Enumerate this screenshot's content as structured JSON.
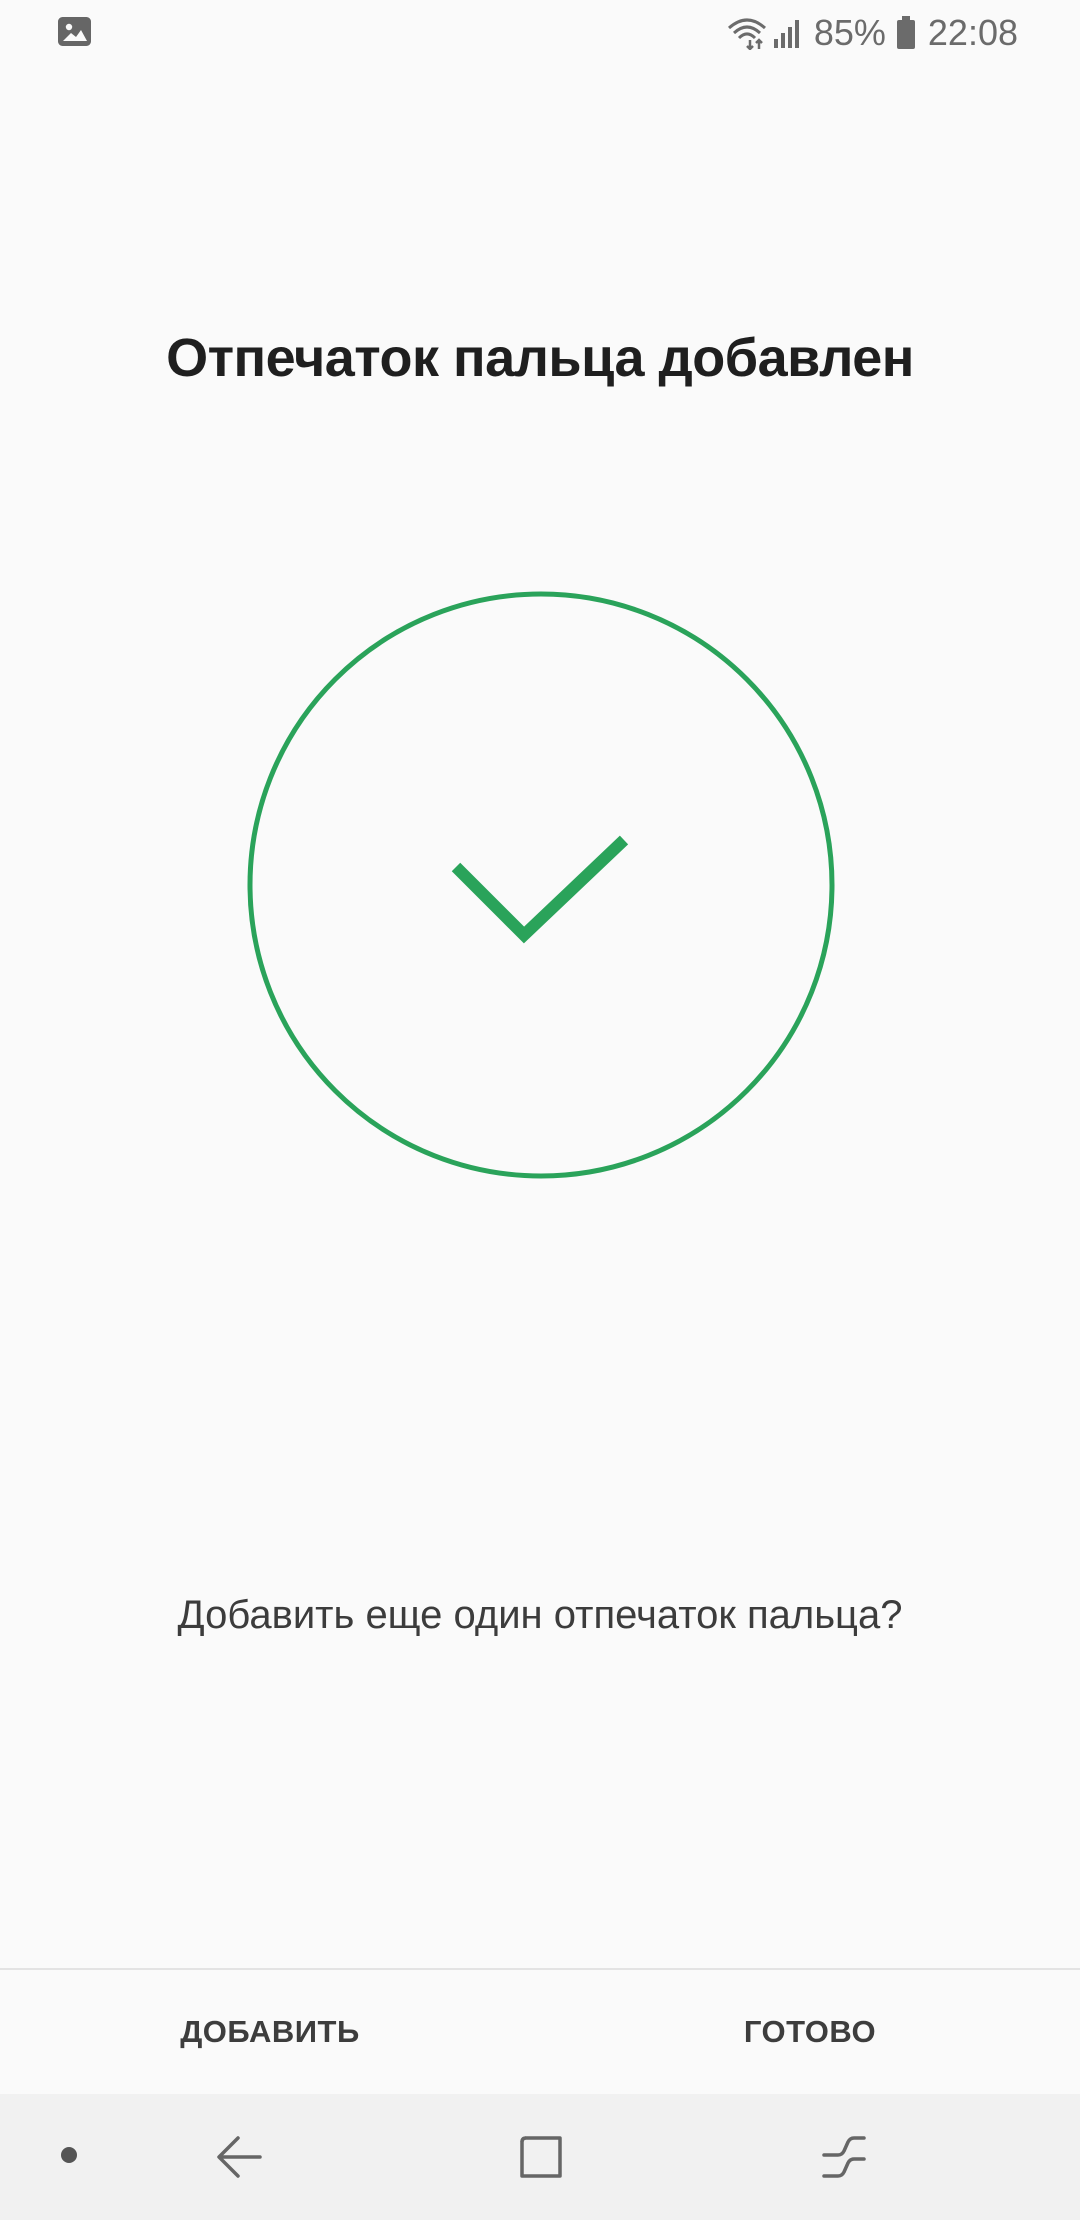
{
  "status_bar": {
    "battery": "85%",
    "time": "22:08"
  },
  "main": {
    "title": "Отпечаток пальца добавлен",
    "prompt": "Добавить еще один отпечаток пальца?"
  },
  "actions": {
    "add_label": "ДОБАВИТЬ",
    "done_label": "ГОТОВО"
  },
  "icons": {
    "gallery": "gallery-notification-icon",
    "wifi": "wifi-icon",
    "signal": "signal-icon",
    "battery": "battery-icon",
    "success": "checkmark-icon",
    "nav_dot": "nav-dot-icon",
    "back": "back-arrow-icon",
    "home": "home-icon",
    "recents": "recents-icon"
  },
  "colors": {
    "accent_green": "#2aa35a",
    "background": "#fafafa",
    "nav_background": "#f1f1f1"
  }
}
